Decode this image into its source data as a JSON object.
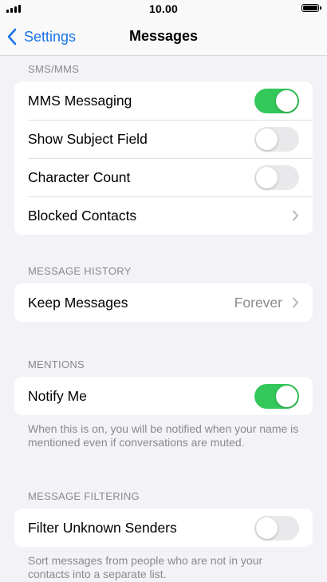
{
  "status_bar": {
    "time": "10.00",
    "signal_icon": "signal-bars-icon",
    "battery_icon": "battery-full-icon"
  },
  "nav": {
    "back_label": "Settings",
    "back_icon": "chevron-left-icon",
    "title": "Messages"
  },
  "sections": {
    "sms_mms": {
      "header": "SMS/MMS",
      "rows": [
        {
          "label": "MMS Messaging",
          "control": "toggle",
          "on": true
        },
        {
          "label": "Show Subject Field",
          "control": "toggle",
          "on": false
        },
        {
          "label": "Character Count",
          "control": "toggle",
          "on": false
        },
        {
          "label": "Blocked Contacts",
          "control": "chevron"
        }
      ]
    },
    "message_history": {
      "header": "MESSAGE HISTORY",
      "rows": [
        {
          "label": "Keep Messages",
          "value": "Forever",
          "control": "chevron"
        }
      ]
    },
    "mentions": {
      "header": "MENTIONS",
      "rows": [
        {
          "label": "Notify Me",
          "control": "toggle",
          "on": true
        }
      ],
      "footer": "When this is on, you will be notified when your name is mentioned even if conversations are muted."
    },
    "message_filtering": {
      "header": "MESSAGE FILTERING",
      "rows": [
        {
          "label": "Filter Unknown Senders",
          "control": "toggle",
          "on": false
        }
      ],
      "footer": "Sort messages from people who are not in your contacts into a separate list."
    }
  },
  "colors": {
    "accent": "#1a73e8",
    "toggle_on": "#34c759",
    "toggle_off": "#e9e9eb",
    "background": "#f2f2f7",
    "secondary_text": "#8a8a8e"
  }
}
